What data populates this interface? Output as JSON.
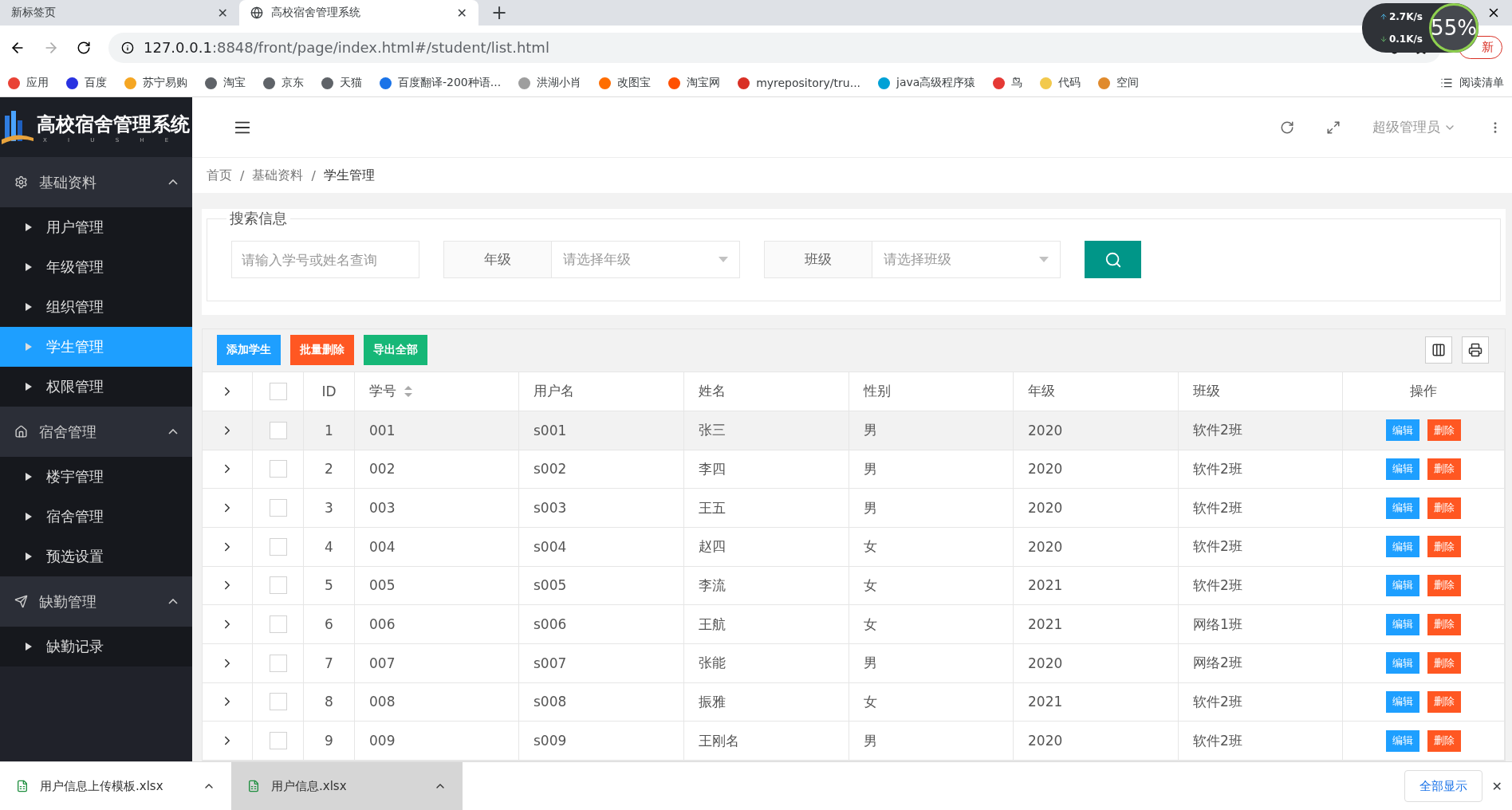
{
  "browser": {
    "tabs": [
      {
        "title": "新标签页",
        "selected": false,
        "close": "✕"
      },
      {
        "title": "高校宿舍管理系统",
        "selected": true,
        "close": "✕"
      }
    ],
    "new_tab": "+",
    "url_host": "127.0.0.1",
    "url_rest": ":8848/front/page/index.html#/student/list.html",
    "update_button": "新",
    "bookmarks": [
      {
        "label": "应用",
        "color": "#e94235"
      },
      {
        "label": "百度",
        "color": "#2932e1"
      },
      {
        "label": "苏宁易购",
        "color": "#f5a623"
      },
      {
        "label": "淘宝",
        "color": "#5f6368"
      },
      {
        "label": "京东",
        "color": "#5f6368"
      },
      {
        "label": "天猫",
        "color": "#5f6368"
      },
      {
        "label": "百度翻译-200种语...",
        "color": "#1a73e8"
      },
      {
        "label": "洪湖小肖",
        "color": "#9e9e9e"
      },
      {
        "label": "改图宝",
        "color": "#ff6d00"
      },
      {
        "label": "淘宝网",
        "color": "#ff5000"
      },
      {
        "label": "myrepository/tru...",
        "color": "#d93025"
      },
      {
        "label": "java高级程序猿",
        "color": "#00a1d6"
      },
      {
        "label": "鸟",
        "color": "#e53935"
      },
      {
        "label": "代码",
        "color": "#f2c94c"
      },
      {
        "label": "空间",
        "color": "#e08a2c"
      }
    ],
    "reading_list": "阅读清单",
    "speed_widget": {
      "up": "2.7",
      "up_unit": "K/s",
      "down": "0.1",
      "down_unit": "K/s",
      "percent": "55",
      "percent_sign": "%"
    }
  },
  "sidebar": {
    "logo_title": "高校宿舍管理系统",
    "logo_sub": "X I U S H E",
    "groups": [
      {
        "label": "基础资料",
        "kind": "gear",
        "expanded": true,
        "items": [
          {
            "label": "用户管理",
            "selected": false
          },
          {
            "label": "年级管理",
            "selected": false
          },
          {
            "label": "组织管理",
            "selected": false
          },
          {
            "label": "学生管理",
            "selected": true
          },
          {
            "label": "权限管理",
            "selected": false
          }
        ]
      },
      {
        "label": "宿舍管理",
        "kind": "home",
        "expanded": true,
        "items": [
          {
            "label": "楼宇管理",
            "selected": false
          },
          {
            "label": "宿舍管理",
            "selected": false
          },
          {
            "label": "预选设置",
            "selected": false
          }
        ]
      },
      {
        "label": "缺勤管理",
        "kind": "send",
        "expanded": true,
        "items": [
          {
            "label": "缺勤记录",
            "selected": false
          }
        ]
      }
    ]
  },
  "header": {
    "user": "超级管理员"
  },
  "breadcrumb": [
    "首页",
    "基础资料",
    "学生管理"
  ],
  "breadcrumb_separator": "/",
  "search": {
    "legend": "搜索信息",
    "keyword_placeholder": "请输入学号或姓名查询",
    "filters": [
      {
        "label": "年级",
        "placeholder": "请选择年级"
      },
      {
        "label": "班级",
        "placeholder": "请选择班级"
      }
    ]
  },
  "toolbar": [
    {
      "label": "添加学生",
      "color": "#1e9fff"
    },
    {
      "label": "批量删除",
      "color": "#ff5722"
    },
    {
      "label": "导出全部",
      "color": "#16b777"
    }
  ],
  "table": {
    "columns": [
      "ID",
      "学号",
      "用户名",
      "姓名",
      "性别",
      "年级",
      "班级",
      "操作"
    ],
    "all_checked": false,
    "rows": [
      {
        "cells": [
          "1",
          "001",
          "s001",
          "张三",
          "男",
          "2020",
          "软件2班"
        ],
        "checked": false,
        "hovered": true,
        "actions": [
          "编辑",
          "删除"
        ]
      },
      {
        "cells": [
          "2",
          "002",
          "s002",
          "李四",
          "男",
          "2020",
          "软件2班"
        ],
        "checked": false,
        "hovered": false,
        "actions": [
          "编辑",
          "删除"
        ]
      },
      {
        "cells": [
          "3",
          "003",
          "s003",
          "王五",
          "男",
          "2020",
          "软件2班"
        ],
        "checked": false,
        "hovered": false,
        "actions": [
          "编辑",
          "删除"
        ]
      },
      {
        "cells": [
          "4",
          "004",
          "s004",
          "赵四",
          "女",
          "2020",
          "软件2班"
        ],
        "checked": false,
        "hovered": false,
        "actions": [
          "编辑",
          "删除"
        ]
      },
      {
        "cells": [
          "5",
          "005",
          "s005",
          "李流",
          "女",
          "2021",
          "软件2班"
        ],
        "checked": false,
        "hovered": false,
        "actions": [
          "编辑",
          "删除"
        ]
      },
      {
        "cells": [
          "6",
          "006",
          "s006",
          "王航",
          "女",
          "2021",
          "网络1班"
        ],
        "checked": false,
        "hovered": false,
        "actions": [
          "编辑",
          "删除"
        ]
      },
      {
        "cells": [
          "7",
          "007",
          "s007",
          "张能",
          "男",
          "2020",
          "网络2班"
        ],
        "checked": false,
        "hovered": false,
        "actions": [
          "编辑",
          "删除"
        ]
      },
      {
        "cells": [
          "8",
          "008",
          "s008",
          "振雅",
          "女",
          "2021",
          "软件2班"
        ],
        "checked": false,
        "hovered": false,
        "actions": [
          "编辑",
          "删除"
        ]
      },
      {
        "cells": [
          "9",
          "009",
          "s009",
          "王刚名",
          "男",
          "2020",
          "软件2班"
        ],
        "checked": false,
        "hovered": false,
        "actions": [
          "编辑",
          "删除"
        ]
      }
    ]
  },
  "downloads": {
    "files": [
      {
        "name": "用户信息上传模板.xlsx",
        "selected": false
      },
      {
        "name": "用户信息.xlsx",
        "selected": true
      }
    ],
    "show_all": "全部显示",
    "close": "✕"
  }
}
